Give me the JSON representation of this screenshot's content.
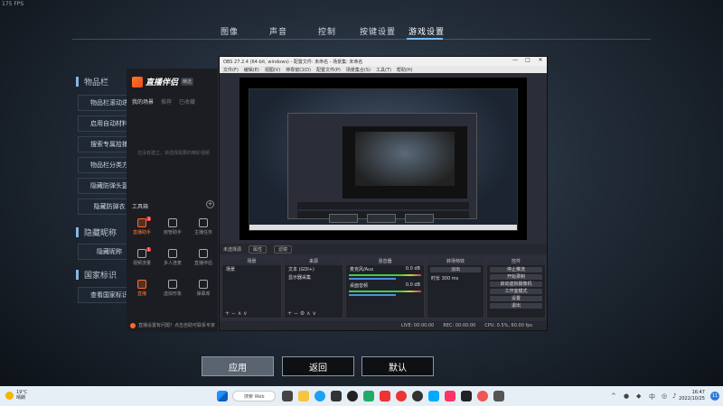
{
  "fps": "175 FPS",
  "game_tabs": [
    "图像",
    "声音",
    "控制",
    "按键设置",
    "游戏设置"
  ],
  "sections": {
    "items_bar": "物品栏",
    "hide_nick": "隐藏昵称",
    "nation": "国家标识"
  },
  "setting_items": [
    "物品栏滚动迭",
    "启用自动材料",
    "搜索专属拾捕",
    "物品栏分类方",
    "隐藏防弹头盔",
    "隐藏防弹衣",
    "隐藏昵称",
    "查看国家标识"
  ],
  "helper": {
    "logo_text": "直播伴侣",
    "logo_badge": "精选",
    "tabs": [
      "我的场景",
      "推荐",
      "已收藏"
    ],
    "empty_msg": "还没有建立，快选择需要的精彩视频",
    "tools_label": "工具箱",
    "tools": [
      "直播助手",
      "房管助手",
      "主播任务",
      "视频流量",
      "多人连麦",
      "直播伴侣",
      "直播",
      "虚拟形象",
      "弹幕库"
    ],
    "footer": "直播设置有问题？点击自助可联系专家"
  },
  "obs": {
    "title": "OBS 27.2.4 (64-bit, windows) - 配置文件: 未命名 - 场景集: 未命名",
    "menu": [
      "文件(F)",
      "编辑(E)",
      "视图(V)",
      "停靠窗口(D)",
      "配置文件(P)",
      "场景集合(S)",
      "工具(T)",
      "帮助(H)"
    ],
    "scene_row": [
      "未选择源",
      "属性",
      "滤镜"
    ],
    "docks": {
      "scenes": "场景",
      "sources": "来源",
      "mixer": "混音器",
      "transitions": "转场特效",
      "controls": "控件"
    },
    "scene_item": "场景",
    "source_items": [
      "文本 (GDI+)",
      "显示器采集"
    ],
    "mixer_items": [
      "麦克风/Aux",
      "桌面音频"
    ],
    "mixer_db": [
      "0.0 dB",
      "0.0 dB"
    ],
    "transition_value": "淡出",
    "duration_label": "时长",
    "duration_value": "300 ms",
    "controls": [
      "停止推流",
      "开始录制",
      "启动虚拟摄像机",
      "工作室模式",
      "设置",
      "退出"
    ],
    "status": [
      "LIVE: 00:00:00",
      "REC: 00:00:00",
      "CPU: 0.5%, 60.00 fps"
    ]
  },
  "buttons": {
    "apply": "应用",
    "back": "返回",
    "default": "默认"
  },
  "taskbar": {
    "weather_temp": "19°C",
    "weather_desc": "晴朗",
    "search": "搜索 Web",
    "time": "16:47",
    "date": "2022/10/25",
    "notif_count": "11"
  }
}
